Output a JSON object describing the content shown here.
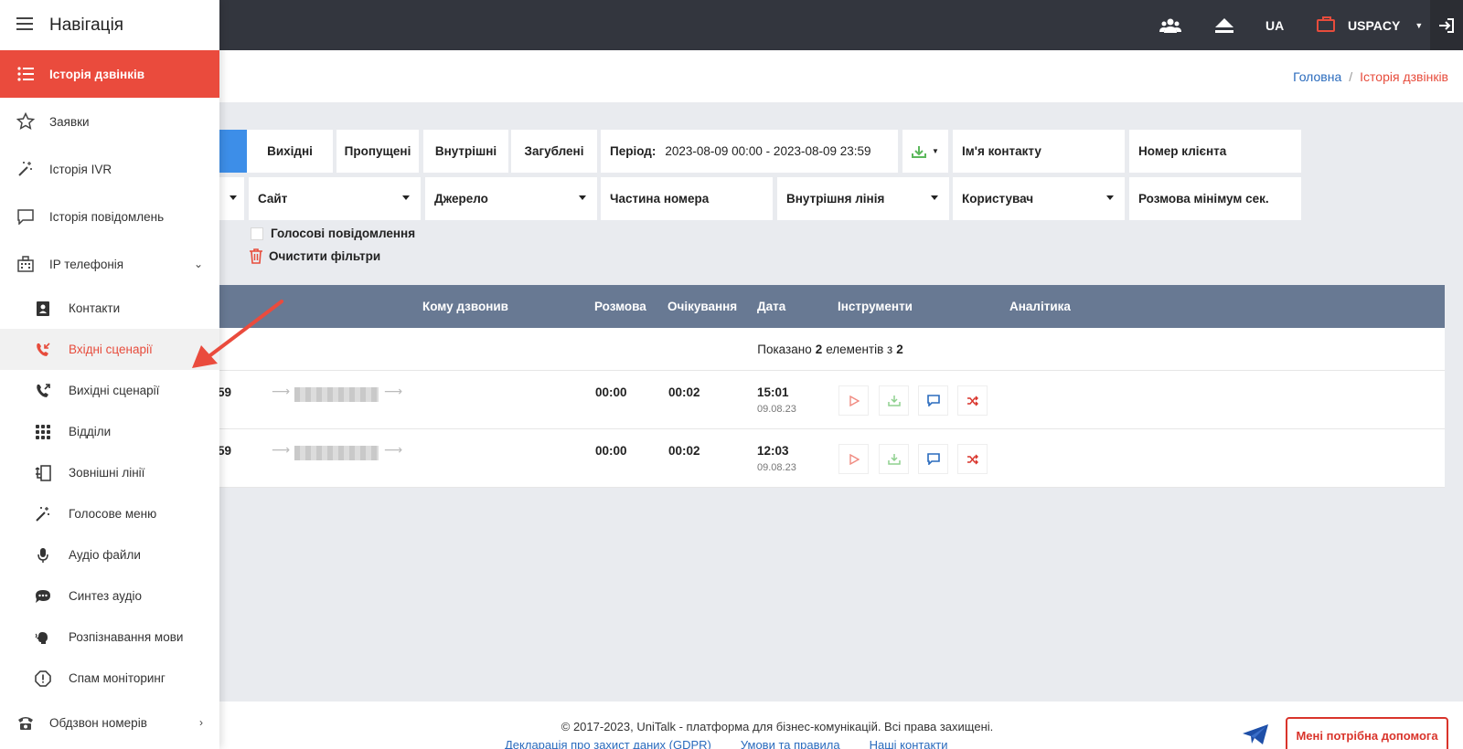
{
  "topbar": {
    "lang": "UA",
    "brand": "USPACY",
    "icons": [
      "users-icon",
      "eject-icon",
      "briefcase-icon",
      "logout-icon"
    ]
  },
  "breadcrumb": {
    "home": "Головна",
    "current": "Історія дзвінків"
  },
  "filters": {
    "tabs": [
      "Вихідні",
      "Пропущені",
      "Внутрішні",
      "Загублені"
    ],
    "period_label": "Період:",
    "period_value": "2023-08-09 00:00 - 2023-08-09 23:59",
    "contact_name": "Ім'я контакту",
    "client_number": "Номер клієнта",
    "site": "Сайт",
    "source": "Джерело",
    "part_number": "Частина номера",
    "internal_line": "Внутрішня лінія",
    "user": "Користувач",
    "min_talk": "Розмова мінімум сек.",
    "voice_messages": "Голосові повідомлення",
    "clear_filters": "Очистити фільтри"
  },
  "table": {
    "headers": {
      "to_whom": "Кому дзвонив",
      "talk": "Розмова",
      "waiting": "Очікування",
      "date": "Дата",
      "tools": "Інструменти",
      "analytics": "Аналітика"
    },
    "summary": {
      "prefix": "Показано",
      "shown": "2",
      "middle": "елементів з",
      "total": "2"
    },
    "rows": [
      {
        "partial_time": "59",
        "talk": "00:00",
        "waiting": "00:02",
        "time": "15:01",
        "date": "09.08.23"
      },
      {
        "partial_time": "59",
        "talk": "00:00",
        "waiting": "00:02",
        "time": "12:03",
        "date": "09.08.23"
      }
    ]
  },
  "footer": {
    "copyright": "© 2017-2023, UniTalk - платформа для бізнес-комунікацій. Всі права захищені.",
    "links": [
      "Декларація про захист даних (GDPR)",
      "Умови та правила",
      "Наші контакти"
    ],
    "help": "Мені потрібна допомога"
  },
  "sidebar": {
    "title": "Навігація",
    "items": [
      {
        "label": "Історія дзвінків",
        "icon": "list-icon"
      },
      {
        "label": "Заявки",
        "icon": "star-icon"
      },
      {
        "label": "Історія IVR",
        "icon": "magic-wand-icon"
      },
      {
        "label": "Історія повідомлень",
        "icon": "chat-icon"
      },
      {
        "label": "IP телефонія",
        "icon": "building-icon"
      }
    ],
    "sub_items": [
      {
        "label": "Контакти",
        "icon": "address-book-icon"
      },
      {
        "label": "Вхідні сценарії",
        "icon": "incoming-call-icon"
      },
      {
        "label": "Вихідні сценарії",
        "icon": "outgoing-call-icon"
      },
      {
        "label": "Відділи",
        "icon": "grid-icon"
      },
      {
        "label": "Зовнішні лінії",
        "icon": "external-line-icon"
      },
      {
        "label": "Голосове меню",
        "icon": "magic-wand-icon"
      },
      {
        "label": "Аудіо файли",
        "icon": "microphone-icon"
      },
      {
        "label": "Синтез аудіо",
        "icon": "speech-bubble-icon"
      },
      {
        "label": "Розпізнавання мови",
        "icon": "voice-recognition-icon"
      },
      {
        "label": "Спам моніторинг",
        "icon": "alert-icon"
      }
    ],
    "last_item": {
      "label": "Обдзвон номерів",
      "icon": "phone-icon"
    }
  },
  "colors": {
    "accent": "#ea4b3d",
    "topbar": "#33363e",
    "table_head": "#687993",
    "link": "#2a6bbd"
  }
}
